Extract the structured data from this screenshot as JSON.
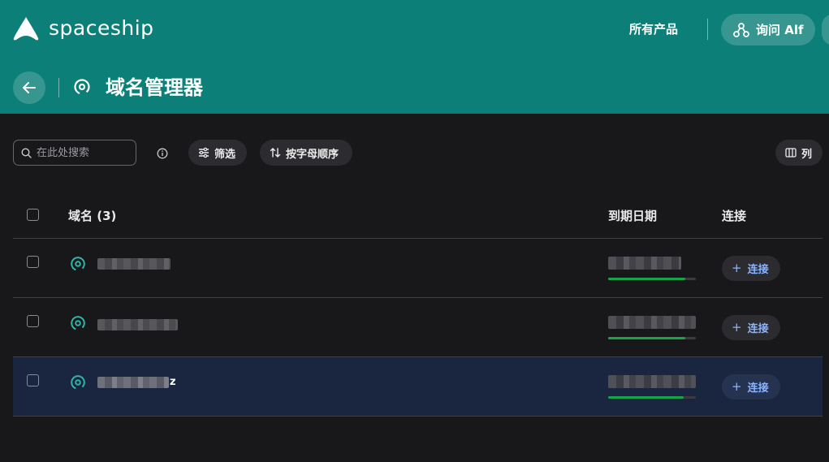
{
  "header": {
    "brand": "spaceship",
    "all_products": "所有产品",
    "ask_alf": "询问 Alf",
    "page_title": "域名管理器"
  },
  "toolbar": {
    "search_placeholder": "在此处搜索",
    "filter_label": "筛选",
    "sort_label": "按字母顺序",
    "columns_label": "列"
  },
  "table": {
    "headers": {
      "domain": "域名 (3)",
      "expiry": "到期日期",
      "connect": "连接"
    },
    "rows": [
      {
        "domain_visible_suffix": "",
        "connect_label": "连接",
        "progress": 0.88,
        "selected": false
      },
      {
        "domain_visible_suffix": "",
        "connect_label": "连接",
        "progress": 0.88,
        "selected": false
      },
      {
        "domain_visible_suffix": "z",
        "connect_label": "连接",
        "progress": 0.86,
        "selected": true
      }
    ]
  },
  "colors": {
    "header_bg": "#0b7f78",
    "page_bg": "#18181b",
    "accent_link": "#8ab4ff",
    "progress": "#17a34a",
    "selected_row": "#1a2540",
    "domain_icon": "#2fb5a6"
  }
}
